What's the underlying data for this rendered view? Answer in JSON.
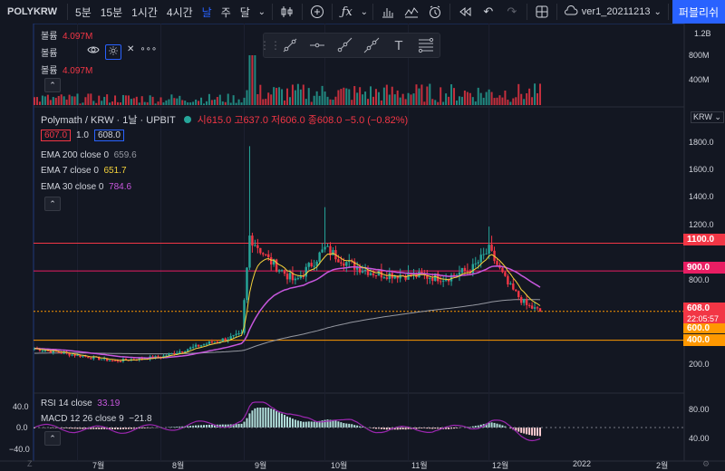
{
  "toolbar": {
    "symbol": "POLYKRW",
    "intervals": [
      "5분",
      "15분",
      "1시간",
      "4시간",
      "날",
      "주",
      "달"
    ],
    "active_interval": "날",
    "version": "ver1_20211213",
    "publish_label": "퍼블리쉬"
  },
  "volume_pane": {
    "label1": "볼륨",
    "value1": "4.097M",
    "label2": "볼륨",
    "label3": "볼륨",
    "value3": "4.097M",
    "axis_ticks": [
      "1.2B",
      "800M",
      "400M"
    ]
  },
  "main_pane": {
    "title": "Polymath / KRW · 1날 · UPBIT",
    "ohlc": {
      "o_label": "시",
      "o": "615.0",
      "h_label": "고",
      "h": "637.0",
      "l_label": "저",
      "l": "606.0",
      "c_label": "종",
      "c": "608.0",
      "change": "−5.0 (−0.82%)"
    },
    "bid": "607.0",
    "spread": "1.0",
    "ask": "608.0",
    "ema200_label": "EMA 200 close 0",
    "ema200_value": "659.6",
    "ema7_label": "EMA 7 close 0",
    "ema7_value": "651.7",
    "ema30_label": "EMA 30 close 0",
    "ema30_value": "784.6",
    "currency": "KRW",
    "price_ticks": [
      "1800.0",
      "1600.0",
      "1400.0",
      "1200.0",
      "800.0",
      "200.0"
    ],
    "tag_1100": "1100.0",
    "tag_900": "900.0",
    "tag_608": "608.0",
    "tag_time": "22:05:57",
    "tag_600": "600.0",
    "tag_400": "400.0"
  },
  "osc_pane": {
    "rsi_label": "RSI 14 close",
    "rsi_value": "33.19",
    "macd_label": "MACD 12 26 close 9",
    "macd_value": "−21.8",
    "left_ticks": [
      "40.0",
      "0.0",
      "−40.0"
    ],
    "right_ticks": [
      "80.00",
      "40.00"
    ]
  },
  "time_axis": [
    "7월",
    "8월",
    "9월",
    "10월",
    "11월",
    "12월",
    "2022",
    "2월"
  ],
  "colors": {
    "up": "#26a69a",
    "down": "#f23645",
    "ema200": "#9598a1",
    "ema7": "#f5d33b",
    "ema30": "#c757dd",
    "accent": "#2962ff"
  },
  "chart_data": {
    "type": "candlestick",
    "title": "Polymath / KRW · 1날 · UPBIT",
    "y_unit": "KRW",
    "x_range": [
      "2021-06-15",
      "2021-12-20"
    ],
    "horizontal_lines": [
      {
        "price": 1100,
        "color": "#f23645"
      },
      {
        "price": 900,
        "color": "#e91e63"
      },
      {
        "price": 608,
        "color": "#ff9800",
        "style": "dotted"
      },
      {
        "price": 400,
        "color": "#ff9800"
      }
    ],
    "close_series_approx": [
      {
        "date": "2021-06-15",
        "close": 340
      },
      {
        "date": "2021-07-01",
        "close": 290
      },
      {
        "date": "2021-07-15",
        "close": 250
      },
      {
        "date": "2021-08-01",
        "close": 280
      },
      {
        "date": "2021-08-15",
        "close": 360
      },
      {
        "date": "2021-08-31",
        "close": 440
      },
      {
        "date": "2021-09-03",
        "close": 1150
      },
      {
        "date": "2021-09-10",
        "close": 980
      },
      {
        "date": "2021-09-20",
        "close": 820
      },
      {
        "date": "2021-10-01",
        "close": 1060
      },
      {
        "date": "2021-10-10",
        "close": 950
      },
      {
        "date": "2021-10-20",
        "close": 880
      },
      {
        "date": "2021-11-01",
        "close": 870
      },
      {
        "date": "2021-11-15",
        "close": 850
      },
      {
        "date": "2021-11-25",
        "close": 920
      },
      {
        "date": "2021-12-01",
        "close": 1050
      },
      {
        "date": "2021-12-08",
        "close": 800
      },
      {
        "date": "2021-12-15",
        "close": 650
      },
      {
        "date": "2021-12-20",
        "close": 608
      }
    ],
    "ema7_last": 651.7,
    "ema30_last": 784.6,
    "ema200_last": 659.6
  }
}
